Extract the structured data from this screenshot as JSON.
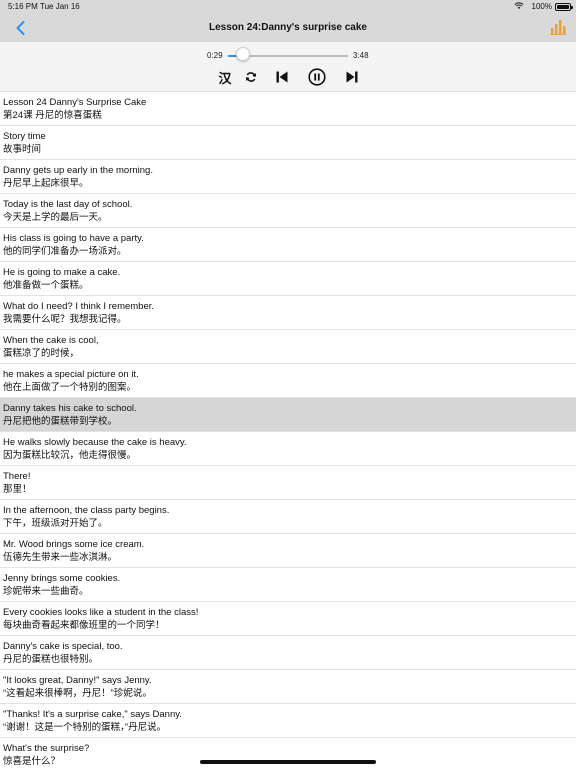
{
  "status_bar": {
    "time": "5:16 PM",
    "date": "Tue Jan 16",
    "battery_text": "100%",
    "wifi_icon": "wifi-icon",
    "battery_icon": "battery-icon"
  },
  "nav": {
    "title": "Lesson 24:Danny's surprise cake",
    "back_icon": "chevron-left-icon",
    "chart_icon": "bar-chart-icon",
    "accent_color": "#2d8ff0",
    "chart_color": "#f0a030"
  },
  "player": {
    "current_time": "0:29",
    "total_time": "3:48",
    "progress": 0.127,
    "hanzi_toggle": "汉",
    "repeat_icon": "repeat-icon",
    "prev_icon": "skip-previous-icon",
    "pause_icon": "pause-circle-icon",
    "next_icon": "skip-next-icon"
  },
  "sentences": [
    {
      "en": "Lesson 24 Danny's Surprise Cake",
      "zh": "第24课 丹尼的惊喜蛋糕",
      "selected": false
    },
    {
      "en": "Story time",
      "zh": "故事时间",
      "selected": false
    },
    {
      "en": "Danny gets up early in the morning.",
      "zh": "丹尼早上起床很早。",
      "selected": false
    },
    {
      "en": "Today is the last day of school.",
      "zh": "今天是上学的最后一天。",
      "selected": false
    },
    {
      "en": "His class is going to have a party.",
      "zh": "他的同学们准备办一场派对。",
      "selected": false
    },
    {
      "en": "He is going to make a cake.",
      "zh": "他准备做一个蛋糕。",
      "selected": false
    },
    {
      "en": "What do I need? I think I remember.",
      "zh": "我需要什么呢？我想我记得。",
      "selected": false
    },
    {
      "en": "When the cake is cool,",
      "zh": "蛋糕凉了的时候，",
      "selected": false
    },
    {
      "en": "he makes a special picture on it.",
      "zh": "他在上面做了一个特别的图案。",
      "selected": false
    },
    {
      "en": "Danny takes his cake to school.",
      "zh": "丹尼把他的蛋糕带到学校。",
      "selected": true
    },
    {
      "en": "He walks slowly because the cake is heavy.",
      "zh": "因为蛋糕比较沉，他走得很慢。",
      "selected": false
    },
    {
      "en": "There!",
      "zh": "那里！",
      "selected": false
    },
    {
      "en": "In the afternoon, the class party begins.",
      "zh": "下午，班级派对开始了。",
      "selected": false
    },
    {
      "en": "Mr. Wood brings some ice cream.",
      "zh": "伍德先生带来一些冰淇淋。",
      "selected": false
    },
    {
      "en": "Jenny brings some cookies.",
      "zh": "珍妮带来一些曲奇。",
      "selected": false
    },
    {
      "en": "Every cookies looks like a student in the class!",
      "zh": "每块曲奇看起来都像班里的一个同学！",
      "selected": false
    },
    {
      "en": "Danny's cake is special, too.",
      "zh": "丹尼的蛋糕也很特别。",
      "selected": false
    },
    {
      "en": "\"It looks great, Danny!\" says Jenny.",
      "zh": "“这看起来很棒啊，丹尼！”珍妮说。",
      "selected": false
    },
    {
      "en": "\"Thanks! It's a surprise cake,\" says Danny.",
      "zh": "“谢谢！这是一个特别的蛋糕，”丹尼说。",
      "selected": false
    },
    {
      "en": "What's the surprise?",
      "zh": "惊喜是什么？",
      "selected": false
    }
  ]
}
